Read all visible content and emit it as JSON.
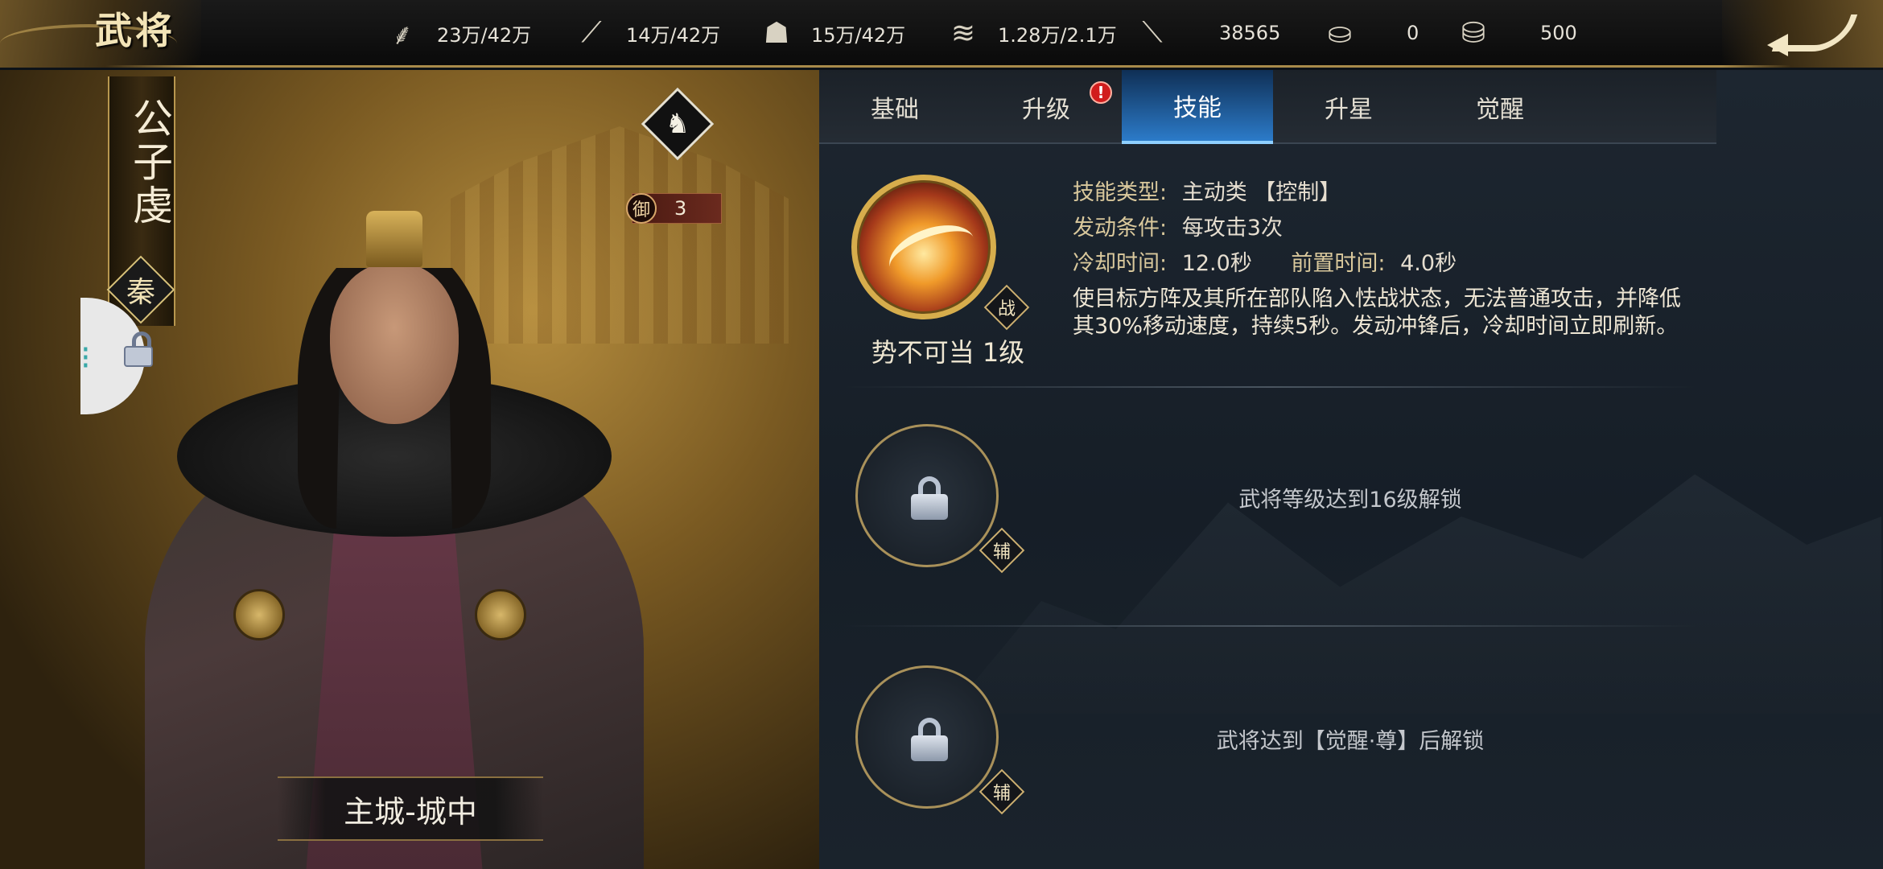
{
  "header": {
    "title": "武将",
    "resources": [
      {
        "icon": "grain-icon",
        "glyph": "⸙",
        "value": "23万/42万"
      },
      {
        "icon": "wood-icon",
        "glyph": "⟋",
        "value": "14万/42万"
      },
      {
        "icon": "stone-icon",
        "glyph": "☗",
        "value": "15万/42万"
      },
      {
        "icon": "iron-icon",
        "glyph": "≋",
        "value": "1.28万/2.1万"
      },
      {
        "icon": "copper-icon",
        "glyph": "⟍",
        "value": "38565"
      },
      {
        "icon": "gold-ingot-icon",
        "glyph": "⛀",
        "value": "0"
      },
      {
        "icon": "silver-ingot-icon",
        "glyph": "⛁",
        "value": "500"
      }
    ]
  },
  "hero": {
    "name": "公子虔",
    "faction": "秦",
    "type_icon": "horse-icon",
    "type_glyph": "♞",
    "defense_label": "御",
    "defense_value": "3",
    "location": "主城-城中"
  },
  "tabs": [
    {
      "label": "基础",
      "active": false,
      "alert": false
    },
    {
      "label": "升级",
      "active": false,
      "alert": true
    },
    {
      "label": "技能",
      "active": true,
      "alert": false
    },
    {
      "label": "升星",
      "active": false,
      "alert": false
    },
    {
      "label": "觉醒",
      "active": false,
      "alert": false
    }
  ],
  "alert_mark": "!",
  "skills": {
    "active": {
      "name_level": "势不可当 1级",
      "tag": "战",
      "type_label": "技能类型:",
      "type_value": "主动类 【控制】",
      "trigger_label": "发动条件:",
      "trigger_value": "每攻击3次",
      "cooldown_label": "冷却时间:",
      "cooldown_value": "12.0秒",
      "precast_label": "前置时间:",
      "precast_value": "4.0秒",
      "description": "使目标方阵及其所在部队陷入怯战状态，无法普通攻击，并降低其30%移动速度，持续5秒。发动冲锋后，冷却时间立即刷新。"
    },
    "locked": [
      {
        "tag": "辅",
        "unlock_text": "武将等级达到16级解锁"
      },
      {
        "tag": "辅",
        "unlock_text": "武将达到【觉醒·尊】后解锁"
      }
    ]
  },
  "colors": {
    "accent_gold": "#d6ad4c",
    "tab_active": "#2c7bc9",
    "alert_red": "#d11d1d"
  }
}
